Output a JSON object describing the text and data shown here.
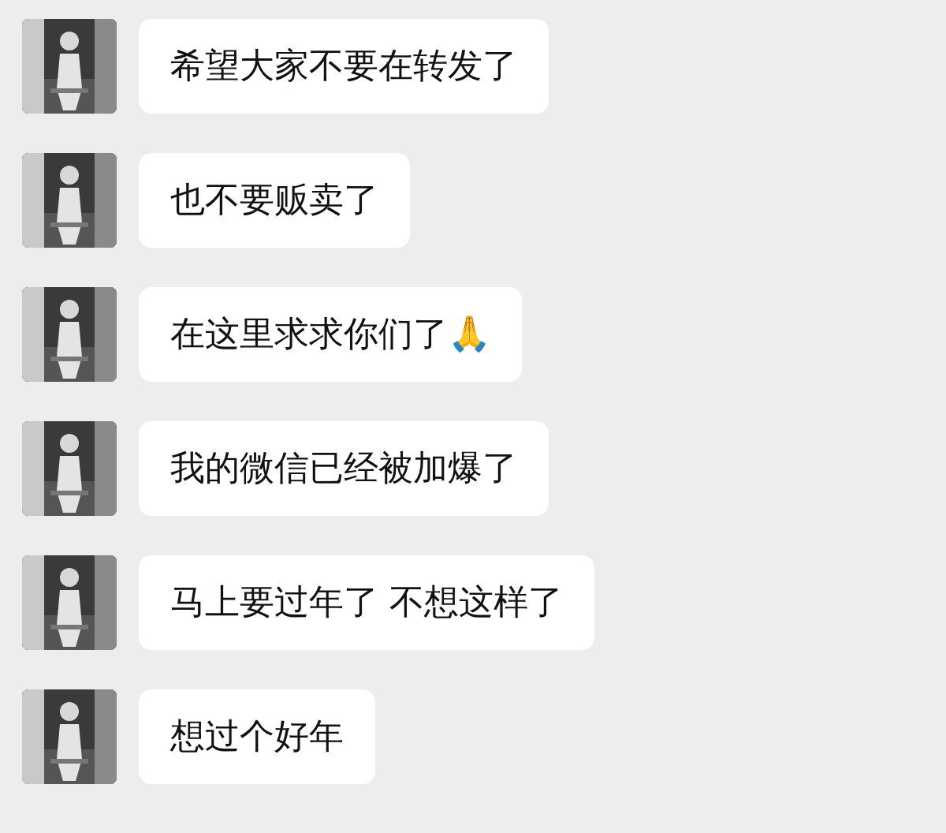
{
  "messages": [
    {
      "text": "希望大家不要在转发了"
    },
    {
      "text": "也不要贩卖了"
    },
    {
      "text": "在这里求求你们了🙏"
    },
    {
      "text": "我的微信已经被加爆了"
    },
    {
      "text": "马上要过年了 不想这样了"
    },
    {
      "text": "想过个好年"
    }
  ]
}
